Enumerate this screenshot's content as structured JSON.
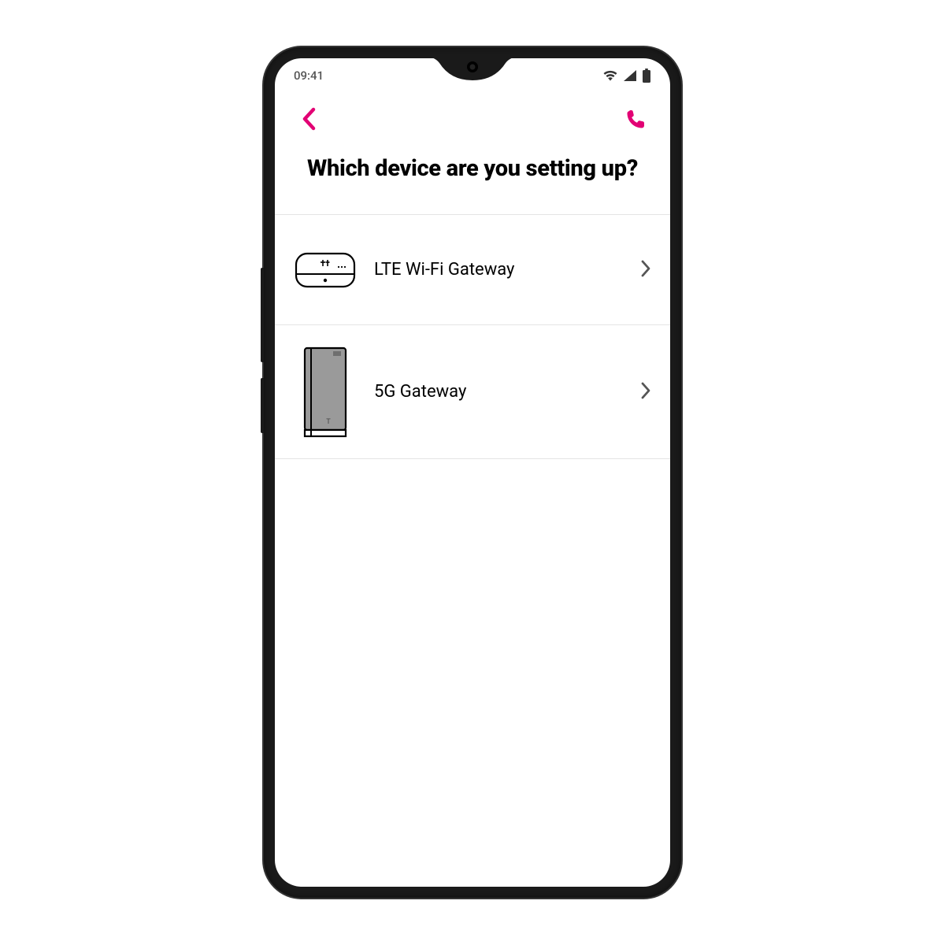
{
  "status": {
    "time": "09:41"
  },
  "colors": {
    "accent": "#E20074",
    "text": "#000000",
    "muted": "#555555",
    "divider": "#e4e4e4"
  },
  "heading": "Which device are you setting up?",
  "items": [
    {
      "label": "LTE Wi-Fi Gateway",
      "icon": "lte-gateway"
    },
    {
      "label": "5G Gateway",
      "icon": "5g-gateway"
    }
  ]
}
